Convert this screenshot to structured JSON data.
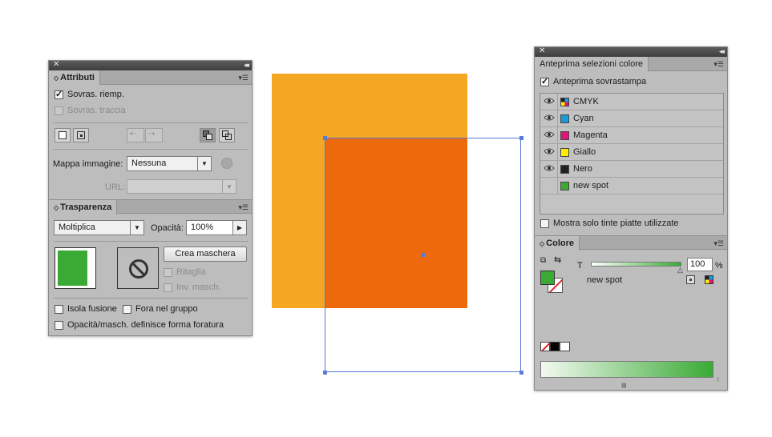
{
  "attributes_panel": {
    "tab_label": "Attributi",
    "overprint_fill_label": "Sovras. riemp.",
    "overprint_fill_checked": true,
    "overprint_stroke_label": "Sovras. traccia",
    "overprint_stroke_checked": false,
    "image_map_label": "Mappa immagine:",
    "image_map_value": "Nessuna",
    "url_label": "URL:",
    "url_value": ""
  },
  "transparency_panel": {
    "tab_label": "Trasparenza",
    "blend_mode": "Moltiplica",
    "opacity_label": "Opacità:",
    "opacity_value": "100%",
    "make_mask_button": "Crea maschera",
    "clip_label": "Ritaglia",
    "invert_mask_label": "Inv. masch.",
    "isolate_blending_label": "Isola fusione",
    "knockout_group_label": "Fora nel gruppo",
    "opacity_mask_knockout_label": "Opacità/masch. definisce forma foratura",
    "thumbnail_color": "#3aaa35"
  },
  "separations_panel": {
    "tab_label": "Anteprima selezioni colore",
    "overprint_preview_label": "Anteprima sovrastampa",
    "overprint_preview_checked": true,
    "items": [
      {
        "name": "CMYK",
        "color": "cmyk",
        "visible": true
      },
      {
        "name": "Cyan",
        "color": "#1a9ad6",
        "visible": true
      },
      {
        "name": "Magenta",
        "color": "#e0137a",
        "visible": true
      },
      {
        "name": "Giallo",
        "color": "#ffed00",
        "visible": true
      },
      {
        "name": "Nero",
        "color": "#222222",
        "visible": true
      },
      {
        "name": "new spot",
        "color": "#3aaa35",
        "visible": false
      }
    ],
    "show_used_spots_label": "Mostra solo tinte piatte utilizzate"
  },
  "color_panel": {
    "tab_label": "Colore",
    "tint_label": "T",
    "tint_value": "100",
    "tint_unit": "%",
    "swatch_name": "new spot",
    "fill_color": "#3aaa35"
  },
  "canvas": {
    "back_rect_color": "#f5a623",
    "front_rect_color": "#ec6a0c",
    "selection_color": "#5a7bd6"
  }
}
